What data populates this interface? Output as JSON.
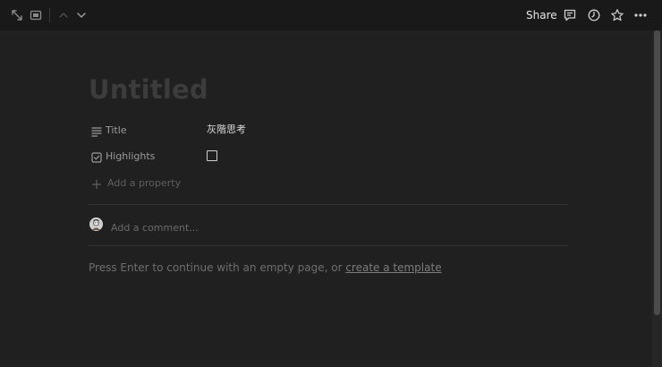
{
  "topbar": {
    "share_label": "Share",
    "icons": [
      "expand-icon",
      "peek-mode-icon",
      "arrow-up-icon",
      "arrow-down-icon",
      "comment-icon",
      "history-icon",
      "star-icon",
      "more-icon"
    ]
  },
  "page": {
    "title_placeholder": "Untitled"
  },
  "properties": [
    {
      "name": "Title",
      "icon": "text-lines-icon",
      "value": "灰階思考"
    },
    {
      "name": "Highlights",
      "icon": "checkbox-property-icon",
      "checked": false
    }
  ],
  "add_property_label": "Add a property",
  "comment": {
    "placeholder": "Add a comment..."
  },
  "hint": {
    "text": "Press Enter to continue with an empty page, or ",
    "link": "create a template"
  },
  "colors": {
    "background": "#191919",
    "content_background": "#202020",
    "text": "#d9d9d9",
    "muted": "#9b9b9b"
  }
}
